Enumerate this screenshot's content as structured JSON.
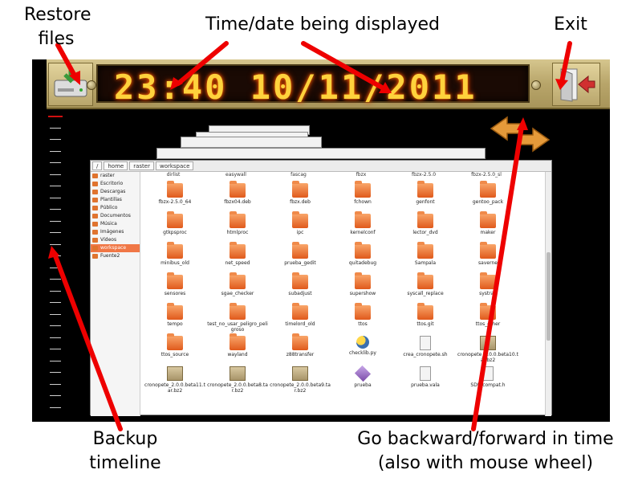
{
  "callouts": {
    "restore": "Restore\nfiles",
    "time": "Time/date being displayed",
    "exit": "Exit",
    "backup": "Backup\ntimeline",
    "nav": "Go backward/forward in time\n(also with mouse wheel)"
  },
  "toolbar": {
    "display": "23:40 10/11/2011",
    "restore_icon": "hard-drive-restore-icon",
    "exit_icon": "door-exit-icon"
  },
  "pathbar": [
    "/",
    "home",
    "raster",
    "workspace"
  ],
  "sidebar": [
    {
      "label": "raster",
      "active": false
    },
    {
      "label": "Escritorio",
      "active": false
    },
    {
      "label": "Descargas",
      "active": false
    },
    {
      "label": "Plantillas",
      "active": false
    },
    {
      "label": "Público",
      "active": false
    },
    {
      "label": "Documentos",
      "active": false
    },
    {
      "label": "Música",
      "active": false
    },
    {
      "label": "Imágenes",
      "active": false
    },
    {
      "label": "Vídeos",
      "active": false
    },
    {
      "label": "workspace",
      "active": true
    },
    {
      "label": "Fuente2",
      "active": false
    }
  ],
  "cut_row": [
    "dirlist",
    "easywall",
    "fascag",
    "fbzx",
    "fbzx-2.5.0",
    "fbzx-2.5.0_sl"
  ],
  "files": [
    {
      "name": "fbzx-2.5.0_64",
      "type": "folder"
    },
    {
      "name": "fbzx04.deb",
      "type": "folder"
    },
    {
      "name": "fbzx.deb",
      "type": "folder"
    },
    {
      "name": "fchown",
      "type": "folder"
    },
    {
      "name": "genfont",
      "type": "folder"
    },
    {
      "name": "gentoo_pack",
      "type": "folder"
    },
    {
      "name": "gtkpsproc",
      "type": "folder"
    },
    {
      "name": "htmlproc",
      "type": "folder"
    },
    {
      "name": "ipc",
      "type": "folder"
    },
    {
      "name": "kernelconf",
      "type": "folder"
    },
    {
      "name": "lector_dvd",
      "type": "folder"
    },
    {
      "name": "maker",
      "type": "folder"
    },
    {
      "name": "minibus_old",
      "type": "folder"
    },
    {
      "name": "net_speed",
      "type": "folder"
    },
    {
      "name": "prueba_gedit",
      "type": "folder"
    },
    {
      "name": "quitadebug",
      "type": "folder"
    },
    {
      "name": "Sampala",
      "type": "folder"
    },
    {
      "name": "saverne",
      "type": "folder"
    },
    {
      "name": "sensores",
      "type": "folder"
    },
    {
      "name": "sgae_checker",
      "type": "folder"
    },
    {
      "name": "subadjust",
      "type": "folder"
    },
    {
      "name": "supershow",
      "type": "folder"
    },
    {
      "name": "syscall_replace",
      "type": "folder"
    },
    {
      "name": "systray",
      "type": "folder"
    },
    {
      "name": "tempo",
      "type": "folder"
    },
    {
      "name": "test_no_usar_peligro_peligroso",
      "type": "folder"
    },
    {
      "name": "timelord_old",
      "type": "folder"
    },
    {
      "name": "ttos",
      "type": "folder"
    },
    {
      "name": "ttos.git",
      "type": "folder"
    },
    {
      "name": "ttos_other",
      "type": "folder"
    },
    {
      "name": "ttos_source",
      "type": "folder"
    },
    {
      "name": "wayland",
      "type": "folder"
    },
    {
      "name": "z88transfer",
      "type": "folder"
    },
    {
      "name": "checklib.py",
      "type": "py"
    },
    {
      "name": "crea_cronopete.sh",
      "type": "doc"
    },
    {
      "name": "cronopete_2.0.0.beta10.tar.bz2",
      "type": "pkg"
    },
    {
      "name": "cronopete_2.0.0.beta11.tar.bz2",
      "type": "pkg"
    },
    {
      "name": "cronopete_2.0.0.beta8.tar.bz2",
      "type": "pkg"
    },
    {
      "name": "cronopete_2.0.0.beta9.tar.bz2",
      "type": "pkg"
    },
    {
      "name": "prueba",
      "type": "gem"
    },
    {
      "name": "prueba.vala",
      "type": "doc"
    },
    {
      "name": "SDL_compat.h",
      "type": "cfile"
    }
  ]
}
